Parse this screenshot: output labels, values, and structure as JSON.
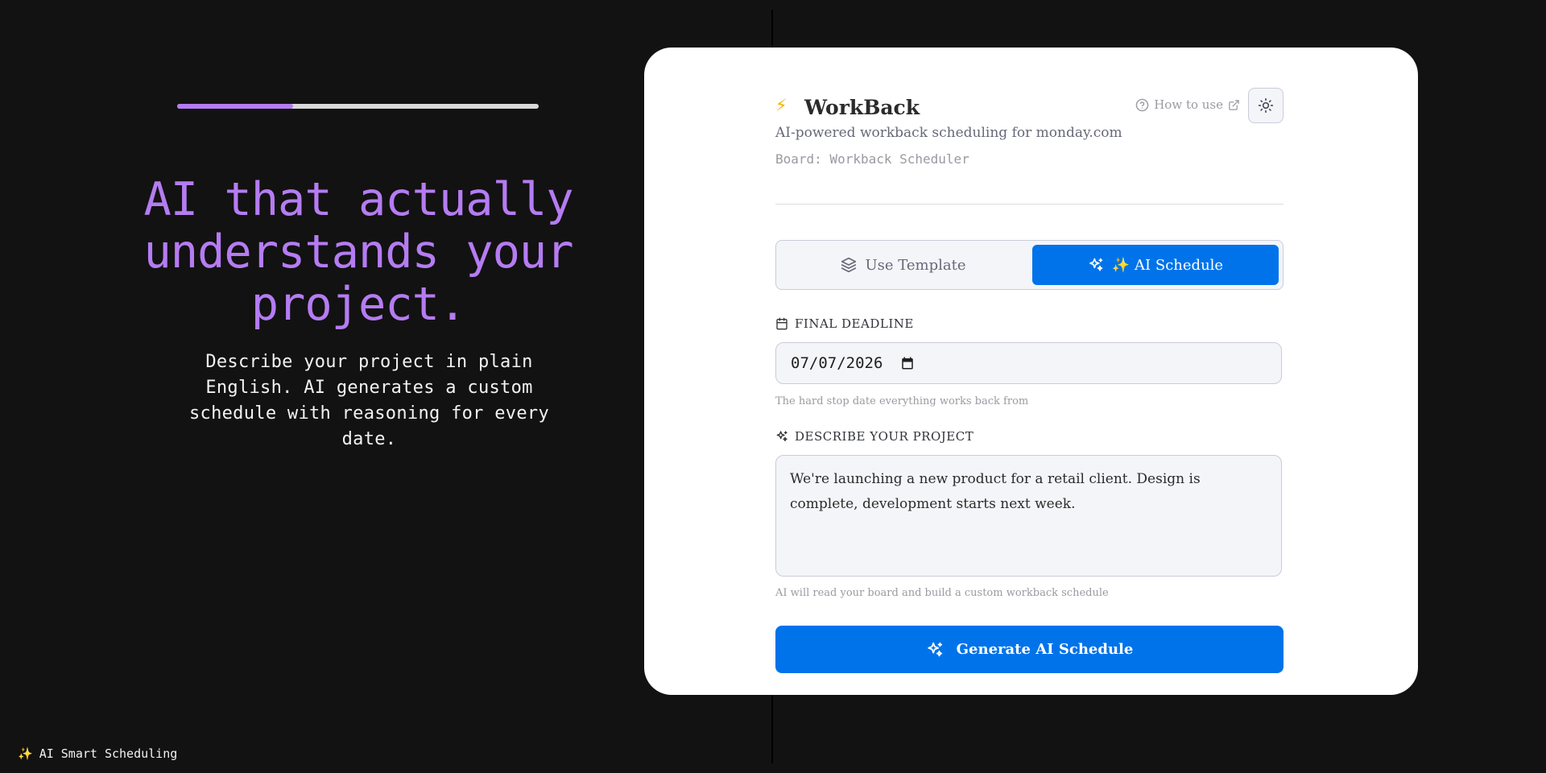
{
  "promo": {
    "progress": 0.32,
    "headline": "AI that actually understands your project.",
    "subtext": "Describe your project in plain English. AI generates a custom schedule with reasoning for every date.",
    "footer_icon": "sparkles-icon",
    "footer_text": "AI Smart Scheduling",
    "accent_color": "#b57cf2"
  },
  "app": {
    "logo_icon": "lightning-bolt-icon",
    "logo_glyph": "⚡",
    "title": "WorkBack",
    "how_to_label": "How to use",
    "theme_toggle_icon": "sun-icon",
    "tagline": "AI-powered workback scheduling for monday.com",
    "board_line": "Board: Workback Scheduler"
  },
  "modes": {
    "template_label": "Use Template",
    "ai_label": "✨ AI Schedule",
    "selected": "ai",
    "selected_color": "#0073ea"
  },
  "deadline": {
    "label": "FINAL DEADLINE",
    "value": "07/07/2026",
    "hint": "The hard stop date everything works back from"
  },
  "description": {
    "label": "DESCRIBE YOUR PROJECT",
    "value": "We're launching a new product for a retail client. Design is complete, development starts next week.",
    "hint": "AI will read your board and build a custom workback schedule"
  },
  "generate_label": "Generate AI Schedule"
}
